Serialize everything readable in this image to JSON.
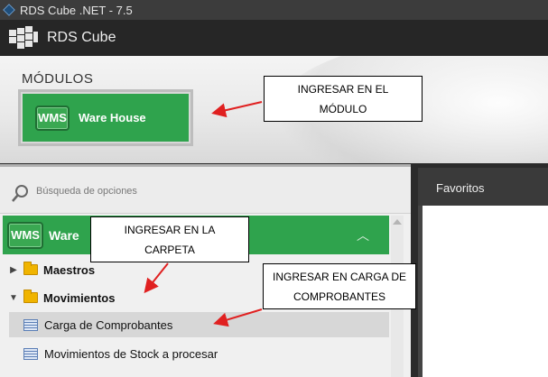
{
  "window": {
    "title": "RDS Cube .NET - 7.5"
  },
  "app": {
    "name": "RDS Cube"
  },
  "modules": {
    "heading": "MÓDULOS",
    "tile": {
      "badge": "WMS",
      "label": "Ware House"
    }
  },
  "search": {
    "placeholder": "Búsqueda de opciones"
  },
  "sidebar": {
    "module": {
      "badge": "WMS",
      "label": "Ware"
    },
    "items": [
      {
        "label": "Maestros",
        "type": "folder",
        "expanded": false
      },
      {
        "label": "Movimientos",
        "type": "folder",
        "expanded": true
      },
      {
        "label": "Carga de Comprobantes",
        "type": "document",
        "selected": true
      },
      {
        "label": "Movimientos de Stock a procesar",
        "type": "document",
        "selected": false
      }
    ]
  },
  "favorites": {
    "title": "Favoritos"
  },
  "annotations": [
    {
      "text": "INGRESAR EN EL MÓDULO"
    },
    {
      "text": "INGRESAR EN LA CARPETA"
    },
    {
      "text": "INGRESAR EN CARGA DE COMPROBANTES"
    }
  ],
  "colors": {
    "module_green": "#2fa34d",
    "arrow_red": "#e02020"
  }
}
